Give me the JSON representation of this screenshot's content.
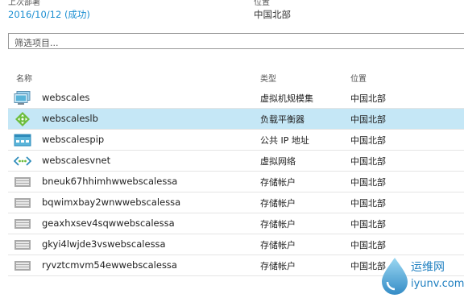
{
  "deployment": {
    "last_label": "上次部署",
    "last_value": "2016/10/12 (成功)",
    "location_label": "位置",
    "location_value": "中国北部"
  },
  "filter": {
    "placeholder": "筛选项目..."
  },
  "columns": {
    "name": "名称",
    "type": "类型",
    "location": "位置"
  },
  "resources": [
    {
      "name": "webscales",
      "type": "虚拟机规模集",
      "location": "中国北部",
      "icon": "vm-scale-set-icon",
      "selected": false
    },
    {
      "name": "webscaleslb",
      "type": "负载平衡器",
      "location": "中国北部",
      "icon": "load-balancer-icon",
      "selected": true
    },
    {
      "name": "webscalespip",
      "type": "公共 IP 地址",
      "location": "中国北部",
      "icon": "public-ip-icon",
      "selected": false
    },
    {
      "name": "webscalesvnet",
      "type": "虚拟网络",
      "location": "中国北部",
      "icon": "virtual-network-icon",
      "selected": false
    },
    {
      "name": "bneuk67hhimhwwebscalessa",
      "type": "存储帐户",
      "location": "中国北部",
      "icon": "storage-account-icon",
      "selected": false
    },
    {
      "name": "bqwimxbay2wnwwebscalessa",
      "type": "存储帐户",
      "location": "中国北部",
      "icon": "storage-account-icon",
      "selected": false
    },
    {
      "name": "geaxhxsev4sqwwebscalessa",
      "type": "存储帐户",
      "location": "中国北部",
      "icon": "storage-account-icon",
      "selected": false
    },
    {
      "name": "gkyi4lwjde3vswebscalessa",
      "type": "存储帐户",
      "location": "中国北部",
      "icon": "storage-account-icon",
      "selected": false
    },
    {
      "name": "ryvztcmvm54ewwebscalessa",
      "type": "存储帐户",
      "location": "中国北部",
      "icon": "storage-account-icon",
      "selected": false
    }
  ],
  "watermark": {
    "title": "运维网",
    "url": "iyunv.com"
  },
  "colors": {
    "accent": "#1a8ed1",
    "selected_row": "#c5e7f6",
    "load_balancer": "#6cbd3d"
  }
}
